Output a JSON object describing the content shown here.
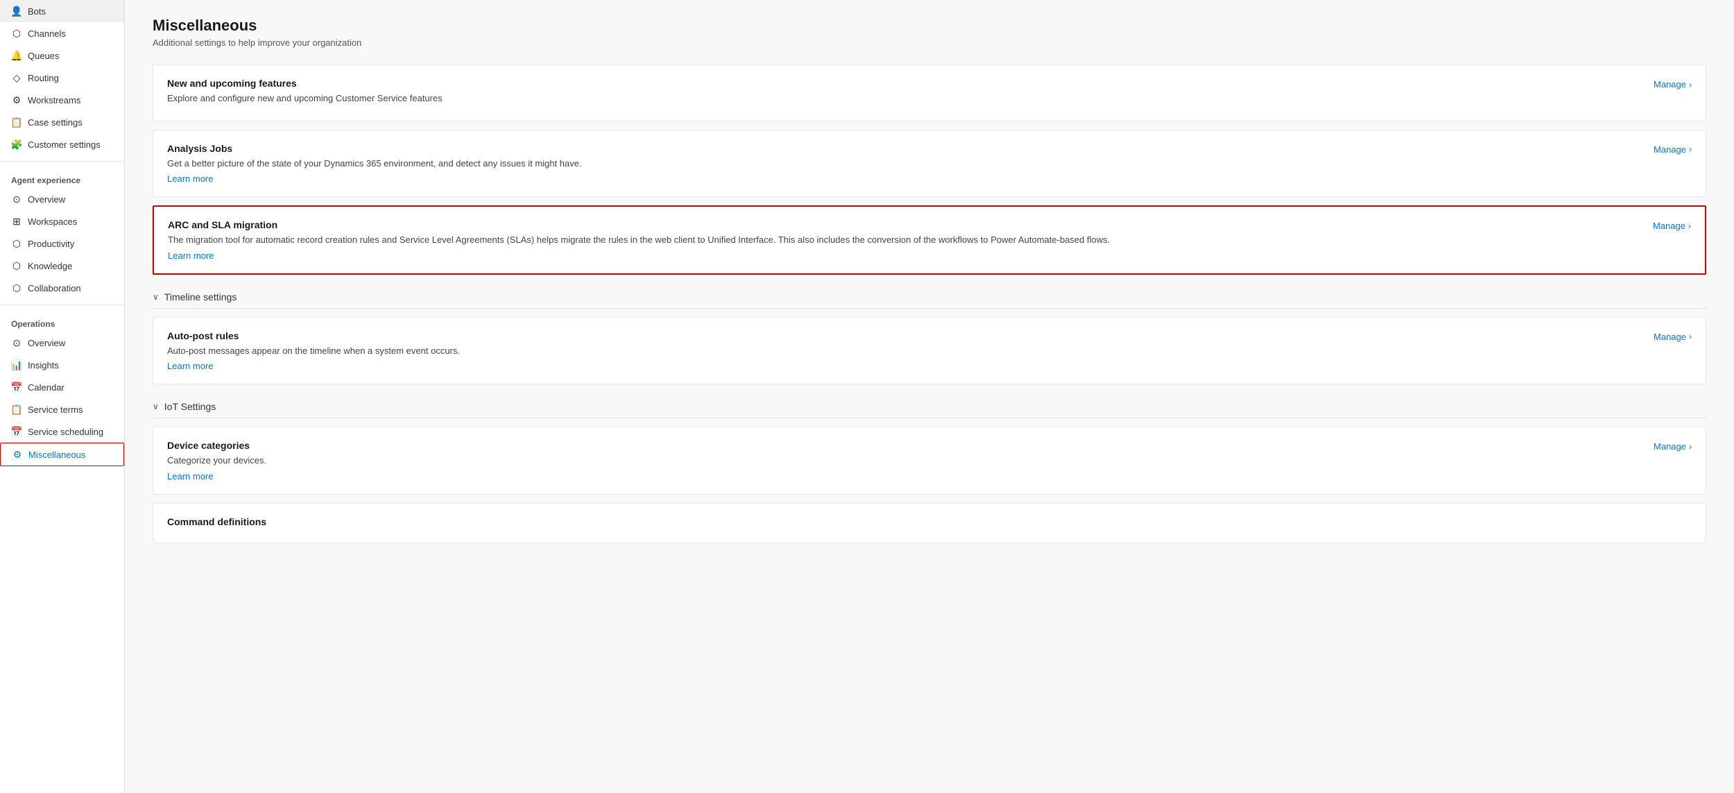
{
  "sidebar": {
    "items_top": [
      {
        "id": "bots",
        "label": "Bots",
        "icon": "👤"
      },
      {
        "id": "channels",
        "label": "Channels",
        "icon": "⬡"
      },
      {
        "id": "queues",
        "label": "Queues",
        "icon": "🔔"
      },
      {
        "id": "routing",
        "label": "Routing",
        "icon": "◇"
      },
      {
        "id": "workstreams",
        "label": "Workstreams",
        "icon": "⚙"
      },
      {
        "id": "case-settings",
        "label": "Case settings",
        "icon": "📋"
      },
      {
        "id": "customer-settings",
        "label": "Customer settings",
        "icon": "🧩"
      }
    ],
    "agent_experience_label": "Agent experience",
    "items_agent": [
      {
        "id": "overview-agent",
        "label": "Overview",
        "icon": "⊙"
      },
      {
        "id": "workspaces",
        "label": "Workspaces",
        "icon": "⊞"
      },
      {
        "id": "productivity",
        "label": "Productivity",
        "icon": "⬡"
      },
      {
        "id": "knowledge",
        "label": "Knowledge",
        "icon": "⬡"
      },
      {
        "id": "collaboration",
        "label": "Collaboration",
        "icon": "⬡"
      }
    ],
    "operations_label": "Operations",
    "items_operations": [
      {
        "id": "overview-ops",
        "label": "Overview",
        "icon": "⊙"
      },
      {
        "id": "insights",
        "label": "Insights",
        "icon": "📊"
      },
      {
        "id": "calendar",
        "label": "Calendar",
        "icon": "📅"
      },
      {
        "id": "service-terms",
        "label": "Service terms",
        "icon": "📋"
      },
      {
        "id": "service-scheduling",
        "label": "Service scheduling",
        "icon": "📅"
      },
      {
        "id": "miscellaneous",
        "label": "Miscellaneous",
        "icon": "⚙",
        "active": true
      }
    ]
  },
  "main": {
    "page_title": "Miscellaneous",
    "page_subtitle": "Additional settings to help improve your organization",
    "cards": [
      {
        "id": "new-features",
        "title": "New and upcoming features",
        "desc": "Explore and configure new and upcoming Customer Service features",
        "link": null,
        "manage_label": "Manage",
        "highlighted": false
      },
      {
        "id": "analysis-jobs",
        "title": "Analysis Jobs",
        "desc": "Get a better picture of the state of your Dynamics 365 environment, and detect any issues it might have.",
        "link": "Learn more",
        "manage_label": "Manage",
        "highlighted": false
      },
      {
        "id": "arc-sla",
        "title": "ARC and SLA migration",
        "desc": "The migration tool for automatic record creation rules and Service Level Agreements (SLAs) helps migrate the rules in the web client to Unified Interface. This also includes the conversion of the workflows to Power Automate-based flows.",
        "link": "Learn more",
        "manage_label": "Manage",
        "highlighted": true
      }
    ],
    "sections": [
      {
        "id": "timeline-settings",
        "label": "Timeline settings",
        "cards": [
          {
            "id": "auto-post-rules",
            "title": "Auto-post rules",
            "desc": "Auto-post messages appear on the timeline when a system event occurs.",
            "link": "Learn more",
            "manage_label": "Manage"
          }
        ]
      },
      {
        "id": "iot-settings",
        "label": "IoT Settings",
        "cards": [
          {
            "id": "device-categories",
            "title": "Device categories",
            "desc": "Categorize your devices.",
            "link": "Learn more",
            "manage_label": "Manage"
          },
          {
            "id": "command-definitions",
            "title": "Command definitions",
            "desc": "",
            "link": null,
            "manage_label": null
          }
        ]
      }
    ]
  }
}
